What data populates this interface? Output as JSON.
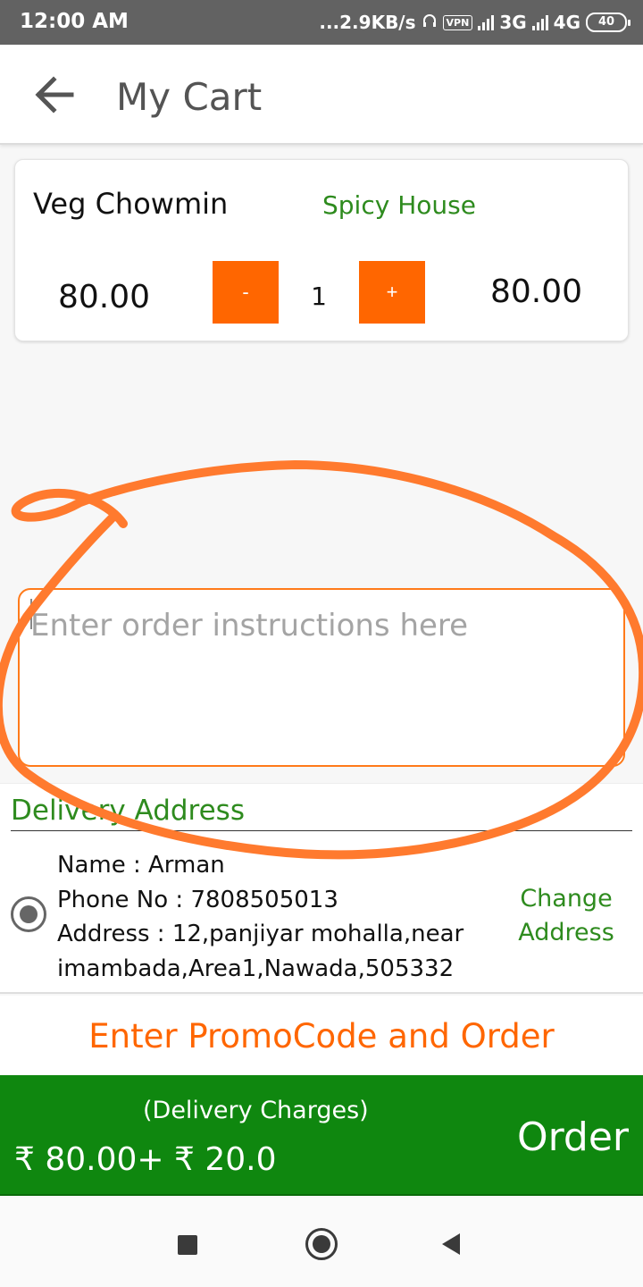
{
  "status_bar": {
    "time": "12:00 AM",
    "network_speed": "...2.9KB/s",
    "vpn": "VPN",
    "net_3g": "3G",
    "net_4g": "4G",
    "battery": "40"
  },
  "header": {
    "title": "My Cart",
    "back_icon": "arrow-left-icon"
  },
  "cart": {
    "items": [
      {
        "name": "Veg Chowmin",
        "restaurant": "Spicy House",
        "unit_price": "80.00",
        "quantity": "1",
        "line_total": "80.00",
        "minus_label": "-",
        "plus_label": "+"
      }
    ]
  },
  "instructions": {
    "placeholder": "Enter order instructions here"
  },
  "delivery": {
    "heading": "Delivery Address",
    "name_line": "Name : Arman",
    "phone_line": "Phone No : 7808505013",
    "address_line1": "Address : 12,panjiyar mohalla,near",
    "address_line2": "imambada,Area1,Nawada,505332",
    "change_line1": "Change",
    "change_line2": "Address"
  },
  "promo": {
    "label": "Enter PromoCode and Order"
  },
  "order_bar": {
    "delivery_label": "(Delivery Charges)",
    "totals": "₹ 80.00+ ₹ 20.0",
    "order_label": "Order"
  },
  "colors": {
    "accent_orange": "#ff6600",
    "brand_green": "#0f870f",
    "text_green": "#2e8b1e",
    "annotation_orange": "#ff7a2e"
  },
  "nav_bar": {
    "icons": [
      "square-recent-icon",
      "circle-home-icon",
      "triangle-back-icon"
    ]
  }
}
